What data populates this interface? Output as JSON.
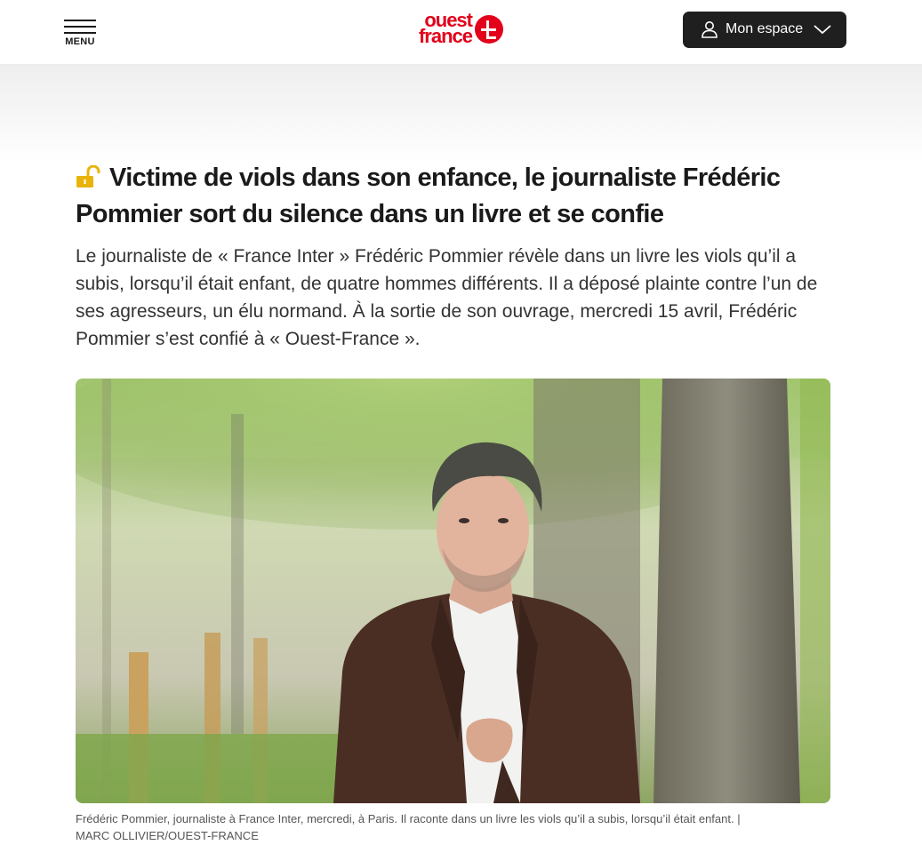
{
  "header": {
    "menu_label": "MENU",
    "logo_line1": "ouest",
    "logo_line2": "france",
    "account_label": "Mon espace",
    "brand_color": "#e2001a"
  },
  "article": {
    "headline": "Victime de viols dans son enfance, le journaliste Frédéric Pommier sort du silence dans un livre et se confie",
    "lock_icon": "open-lock-icon",
    "chapo": "Le journaliste de « France Inter » Frédéric Pommier révèle dans un livre les viols qu’il a subis, lorsqu’il était enfant, de quatre hommes différents. Il a déposé plainte contre l’un de ses agresseurs, un élu normand. À la sortie de son ouvrage, mercredi 15 avril, Frédéric Pommier s’est confié à « Ouest-France ».",
    "photo_caption": "Frédéric Pommier, journaliste à France Inter, mercredi, à Paris. Il raconte dans un livre les viols qu’il a subis, lorsqu’il était enfant. |",
    "photo_credit": "MARC OLLIVIER/OUEST-FRANCE"
  }
}
